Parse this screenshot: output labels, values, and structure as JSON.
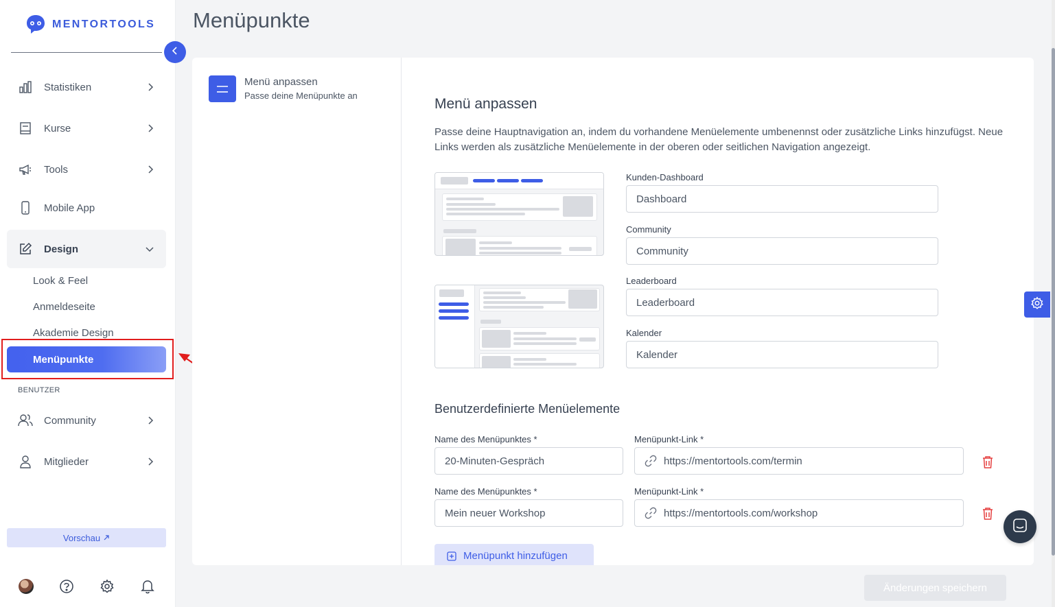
{
  "app": {
    "logo_text": "MENTORTOOLS"
  },
  "sidebar": {
    "items": [
      {
        "label": "Statistiken",
        "icon": "bar-chart-icon"
      },
      {
        "label": "Kurse",
        "icon": "book-icon"
      },
      {
        "label": "Tools",
        "icon": "megaphone-icon"
      },
      {
        "label": "Mobile App",
        "icon": "mobile-icon"
      },
      {
        "label": "Design",
        "icon": "edit-icon"
      }
    ],
    "design_sub": [
      "Look & Feel",
      "Anmeldeseite",
      "Akademie Design",
      "Menüpunkte"
    ],
    "section_users": "BENUTZER",
    "user_items": [
      {
        "label": "Community",
        "icon": "users-icon"
      },
      {
        "label": "Mitglieder",
        "icon": "user-icon"
      }
    ],
    "preview_label": "Vorschau"
  },
  "page": {
    "title": "Menüpunkte",
    "step": {
      "title": "Menü anpassen",
      "subtitle": "Passe deine Menüpunkte an"
    },
    "section_title": "Menü anpassen",
    "description": "Passe deine Hauptnavigation an, indem du vorhandene Menüelemente umbenennst oder zusätzliche Links hinzufügst. Neue Links werden als zusätzliche Menüelemente in der oberen oder seitlichen Navigation angezeigt.",
    "fields": [
      {
        "label": "Kunden-Dashboard",
        "value": "Dashboard"
      },
      {
        "label": "Community",
        "value": "Community"
      },
      {
        "label": "Leaderboard",
        "value": "Leaderboard"
      },
      {
        "label": "Kalender",
        "value": "Kalender"
      }
    ],
    "custom_title": "Benutzerdefinierte Menüelemente",
    "custom_items": [
      {
        "name_label": "Name des Menüpunktes *",
        "name": "20-Minuten-Gespräch",
        "link_label": "Menüpunkt-Link *",
        "link": "https://mentortools.com/termin"
      },
      {
        "name_label": "Name des Menüpunktes *",
        "name": "Mein neuer Workshop",
        "link_label": "Menüpunkt-Link *",
        "link": "https://mentortools.com/workshop"
      }
    ],
    "add_label": "Menüpunkt hinzufügen",
    "save_label": "Änderungen speichern"
  },
  "colors": {
    "accent": "#3e5de6",
    "highlight": "#e11d1d"
  }
}
